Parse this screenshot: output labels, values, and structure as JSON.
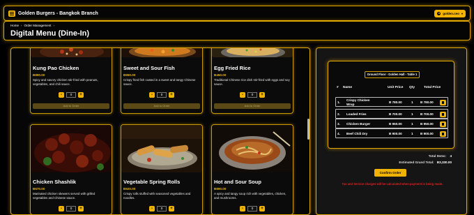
{
  "app": {
    "brand": "Golden Burgers - Bangkok Branch",
    "user": "golden.ceo"
  },
  "breadcrumb": [
    "Home",
    "Order Management"
  ],
  "page_title": "Digital Menu (Dine-In)",
  "menu": {
    "quantity_default": "0",
    "add_label": "Add to Order",
    "items": [
      {
        "name": "Kung Pao Chicken",
        "price": "B890.00",
        "desc": "Spicy and savory chicken stir-fried with peanuts, vegetables, and chili sauce."
      },
      {
        "name": "Sweet and Sour Fish",
        "price": "B950.00",
        "desc": "Crispy fried fish coated in a sweet and tangy Chinese sauce."
      },
      {
        "name": "Egg Fried Rice",
        "price": "B450.00",
        "desc": "Traditional Chinese rice dish stir-fried with eggs and soy sauce."
      },
      {
        "name": "Chicken Shashlik",
        "price": "B670.00",
        "desc": "Marinated chicken skewers served with grilled vegetables and Chinese sauce."
      },
      {
        "name": "Vegetable Spring Rolls",
        "price": "B620.00",
        "desc": "Crispy rolls stuffed with seasoned vegetables and noodles."
      },
      {
        "name": "Hot and Sour Soup",
        "price": "B890.00",
        "desc": "A spicy and tangy soup rich with vegetables, chicken, and mushrooms."
      }
    ]
  },
  "order": {
    "table_label": "Ground Floor - Golden Hall - Table 1",
    "columns": [
      "#",
      "Name",
      "Unit Price",
      "Qty",
      "Total Price"
    ],
    "rows": [
      {
        "n": "1.",
        "name": "Crispy Chicken Wrap",
        "unit": "B 780.00",
        "qty": "1",
        "total": "B 780.00"
      },
      {
        "n": "2.",
        "name": "Loaded Fries",
        "unit": "B 700.00",
        "qty": "1",
        "total": "B 700.00"
      },
      {
        "n": "3.",
        "name": "Chicken Burger",
        "unit": "B 950.00",
        "qty": "1",
        "total": "B 950.00"
      },
      {
        "n": "4.",
        "name": "Beef Chili Dry",
        "unit": "B 900.00",
        "qty": "1",
        "total": "B 900.00"
      }
    ],
    "total_items_label": "Total Items:",
    "total_items": "4",
    "grand_total_label": "Estimated Grand Total:",
    "grand_total": "B3,330.00",
    "confirm_label": "Confirm Order",
    "note": "Tax and Service charges will be calculated when payment is being made."
  },
  "colors": {
    "accent": "#f0b400",
    "warning": "#e02020",
    "background": "#000000"
  }
}
